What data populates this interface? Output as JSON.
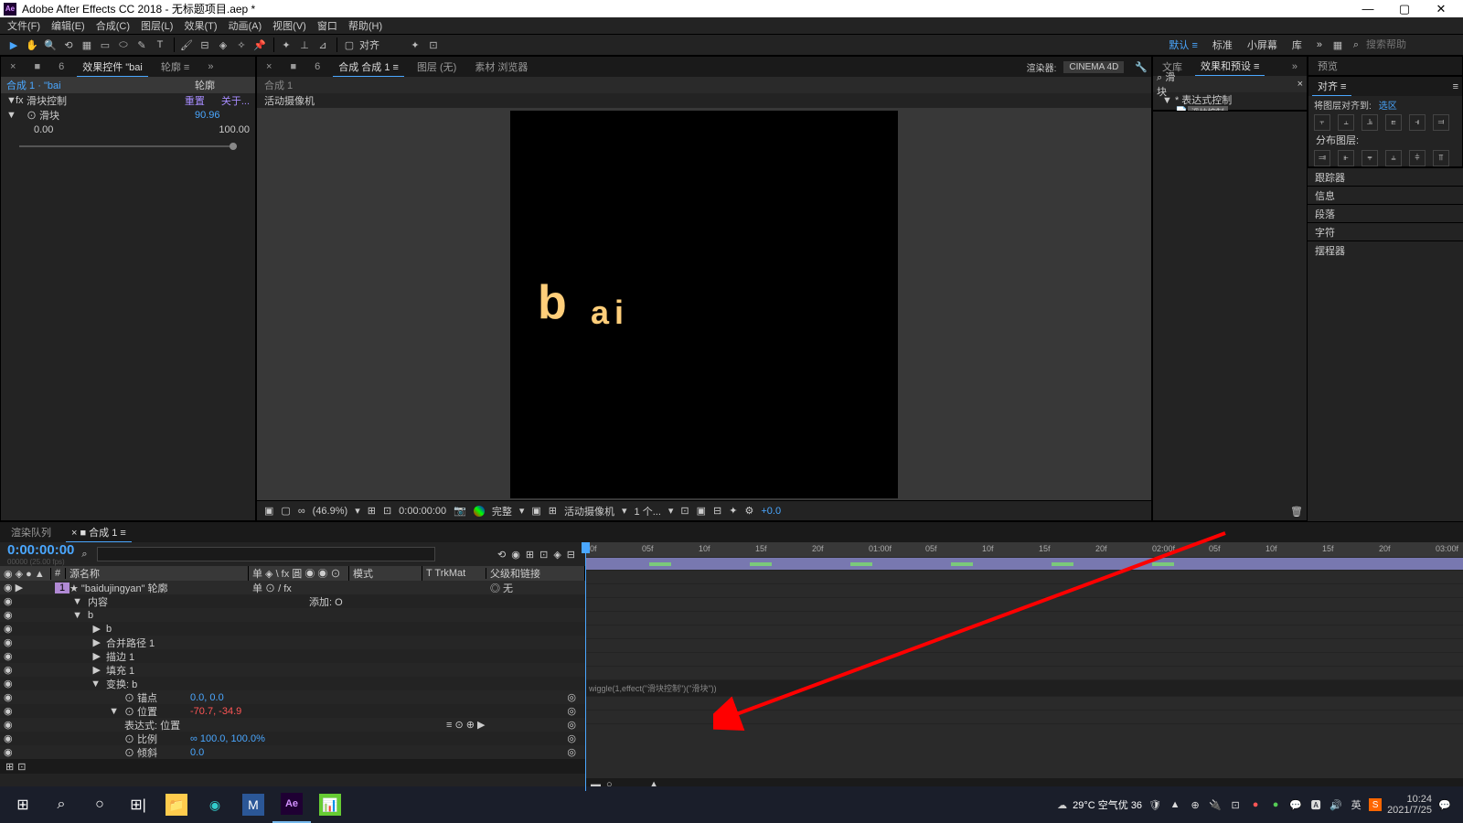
{
  "window": {
    "title": "Adobe After Effects CC 2018 - 无标题项目.aep *",
    "min": "—",
    "max": "▢",
    "close": "✕"
  },
  "menu": [
    "文件(F)",
    "编辑(E)",
    "合成(C)",
    "图层(L)",
    "效果(T)",
    "动画(A)",
    "视图(V)",
    "窗口",
    "帮助(H)"
  ],
  "toolbar": {
    "align_label": "对齐",
    "workspaces": [
      "默认 ≡",
      "标准",
      "小屏幕",
      "库",
      "»"
    ],
    "search_placeholder": "搜索帮助"
  },
  "effect_controls": {
    "tabs": [
      "合成 1",
      "•",
      "■",
      "6",
      "效果控件 \"bai",
      "轮廓 ≡",
      "»"
    ],
    "breadcrumb": "合成 1 · \"bai",
    "col2": "轮廓",
    "effect_name": "滑块控制",
    "reset": "重置",
    "about": "关于...",
    "slider_label": "⊙ 滑块",
    "slider_val": "90.96",
    "slider_min": "0.00",
    "slider_max": "100.00"
  },
  "viewer": {
    "tabs": [
      "×",
      "■",
      "6",
      "合成 合成 1 ≡",
      "图层 (无)",
      "素材 浏览器"
    ],
    "comp_name": "合成 1",
    "active_cam": "活动摄像机",
    "text_b": "b",
    "text_ai": "ai",
    "footer": {
      "zoom": "(46.9%)",
      "time": "0:00:00:00",
      "quality": "完整",
      "view": "活动摄像机",
      "views": "1 个...",
      "exp": "+0.0"
    },
    "renderer_label": "渲染器:",
    "renderer": "CINEMA 4D"
  },
  "effects_presets": {
    "tab1": "文库",
    "tab2": "效果和预设 ≡",
    "search_label": "⌕ 滑块",
    "group": "▼ * 表达式控制",
    "item": "滑块控制"
  },
  "right_panels": {
    "tab": "预览",
    "align_title": "对齐 ≡",
    "align_to": "将图层对齐到:",
    "align_target": "选区",
    "distribute": "分布图层:",
    "segs": [
      "跟踪器",
      "信息",
      "段落",
      "字符",
      "摆程器"
    ]
  },
  "timeline": {
    "tab_render": "渲染队列",
    "tab_comp": "× ■ 合成 1 ≡",
    "timecode": "0:00:00:00",
    "timecode_sub": "00000 (25.00 fps)",
    "hdr": {
      "icons": "◉ ◈ ● ▲",
      "num": "#",
      "source": "源名称",
      "switches": "单 ◈ \\ fx 圓 ◉ ◉ ⊙",
      "mode": "模式",
      "trkmat": "T   TrkMat",
      "parent": "父级和链接"
    },
    "layer": {
      "num": "1",
      "name": "★  \"baidujingyan\" 轮廓",
      "switches": "单 ⊙ / fx",
      "parent": "◎  无"
    },
    "rows": [
      {
        "t": "▼",
        "n": "内容",
        "v": "",
        "m": "添加: O"
      },
      {
        "t": "▼",
        "n": "b",
        "v": "",
        "m": ""
      },
      {
        "t": "▶",
        "n": "b",
        "v": "",
        "m": ""
      },
      {
        "t": "▶",
        "n": "合并路径 1",
        "v": "",
        "m": ""
      },
      {
        "t": "▶",
        "n": "描边 1",
        "v": "",
        "m": ""
      },
      {
        "t": "▶",
        "n": "填充 1",
        "v": "",
        "m": ""
      },
      {
        "t": "▼",
        "n": "变换: b",
        "v": "",
        "m": ""
      },
      {
        "t": "",
        "n": "⊙ 锚点",
        "v": "0.0, 0.0",
        "m": ""
      },
      {
        "t": "▼",
        "n": "⊙ 位置",
        "v": "-70.7, -34.9",
        "m": "",
        "red": true
      },
      {
        "t": "",
        "n": "表达式: 位置",
        "v": "",
        "m": "",
        "expr": true
      },
      {
        "t": "",
        "n": "⊙ 比例",
        "v": "∞ 100.0, 100.0%",
        "m": ""
      },
      {
        "t": "",
        "n": "⊙ 倾斜",
        "v": "0.0",
        "m": ""
      }
    ],
    "ruler": [
      "00f",
      "05f",
      "10f",
      "15f",
      "20f",
      "01:00f",
      "05f",
      "10f",
      "15f",
      "20f",
      "02:00f",
      "05f",
      "10f",
      "15f",
      "20f",
      "03:00f"
    ],
    "expression": "wiggle(1,effect(\"滑块控制\")(\"滑块\"))"
  },
  "taskbar": {
    "weather": "29°C 空气优 36",
    "ime": "英",
    "clock_time": "10:24",
    "clock_date": "2021/7/25"
  }
}
